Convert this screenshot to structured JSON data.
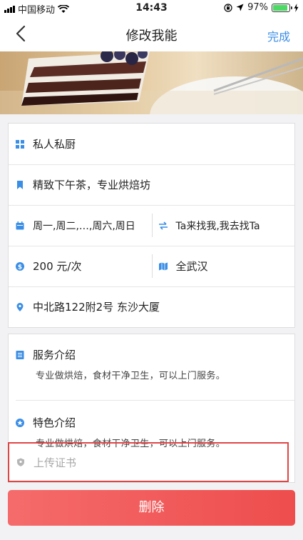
{
  "status_bar": {
    "carrier": "中国移动",
    "time": "14:43",
    "battery_percent": "97%"
  },
  "nav": {
    "title": "修改我能",
    "done_label": "完成"
  },
  "info": {
    "category": "私人私厨",
    "tagline": "精致下午茶，专业烘焙坊",
    "schedule": "周一,周二,…,周六,周日",
    "mode": "Ta来找我,我去找Ta",
    "price": "200 元/次",
    "area": "全武汉",
    "address": "中北路122附2号 东沙大厦"
  },
  "service_intro": {
    "title": "服务介绍",
    "desc": "专业做烘焙，食材干净卫生，可以上门服务。"
  },
  "feature_intro": {
    "title": "特色介绍",
    "desc": "专业做烘焙，食材干净卫生，可以上门服务。"
  },
  "upload": {
    "label": "上传证书"
  },
  "delete_label": "删除",
  "colors": {
    "accent_blue": "#3a8ee6",
    "danger_red": "#ee4d4d",
    "battery_green": "#4cd964"
  }
}
